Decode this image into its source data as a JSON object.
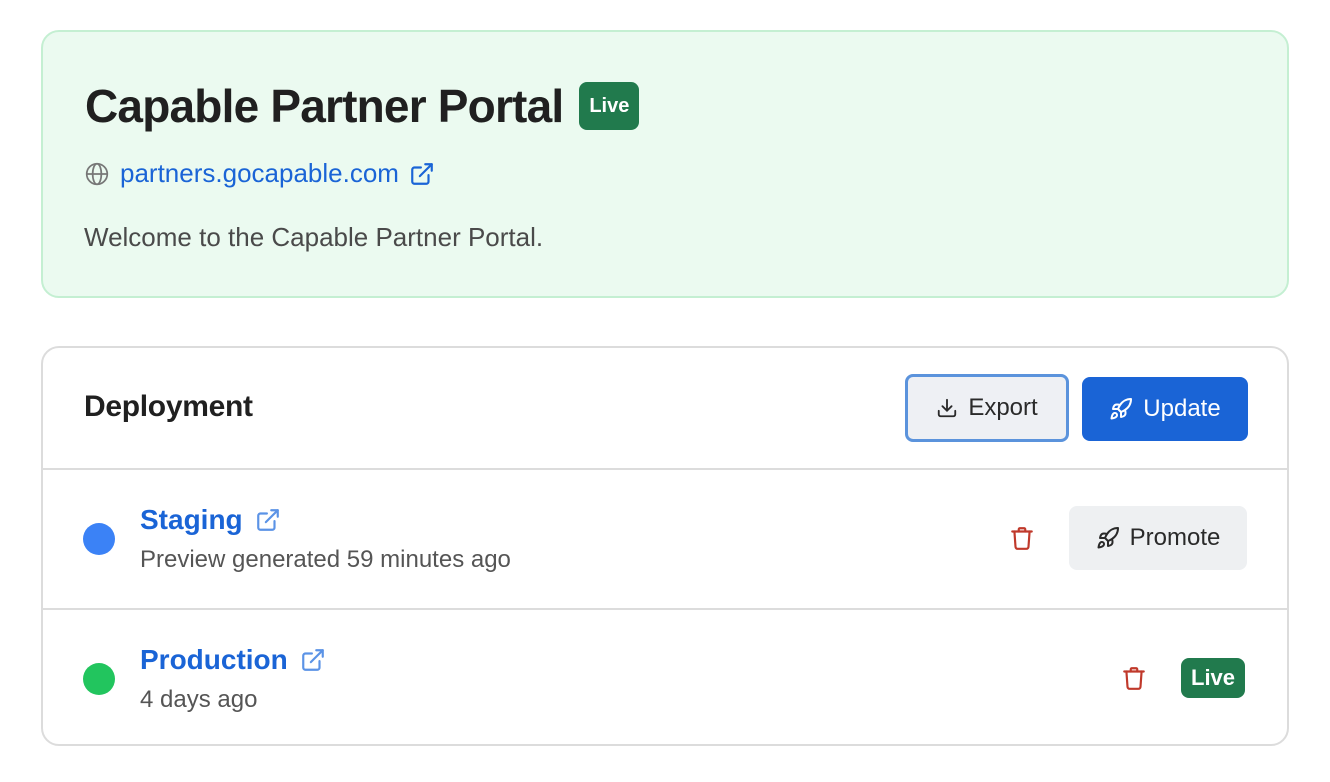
{
  "hero": {
    "title": "Capable Partner Portal",
    "status_badge": "Live",
    "url_text": "partners.gocapable.com",
    "description": "Welcome to the Capable Partner Portal."
  },
  "deployment": {
    "title": "Deployment",
    "export_label": "Export",
    "update_label": "Update",
    "environments": [
      {
        "name": "Staging",
        "subtitle": "Preview generated 59 minutes ago",
        "dot_color": "#3b82f6",
        "action_label": "Promote"
      },
      {
        "name": "Production",
        "subtitle": "4 days ago",
        "dot_color": "#22c55e",
        "status_badge": "Live"
      }
    ]
  },
  "colors": {
    "accent": "#1a64d6",
    "live_green": "#217a4d",
    "danger": "#c0392b",
    "hero_bg": "#ebfaf0"
  },
  "icons": {
    "globe": "globe-icon",
    "external": "external-link-icon",
    "export": "download-icon",
    "update": "rocket-icon",
    "delete": "trash-icon",
    "promote": "rocket-icon"
  }
}
